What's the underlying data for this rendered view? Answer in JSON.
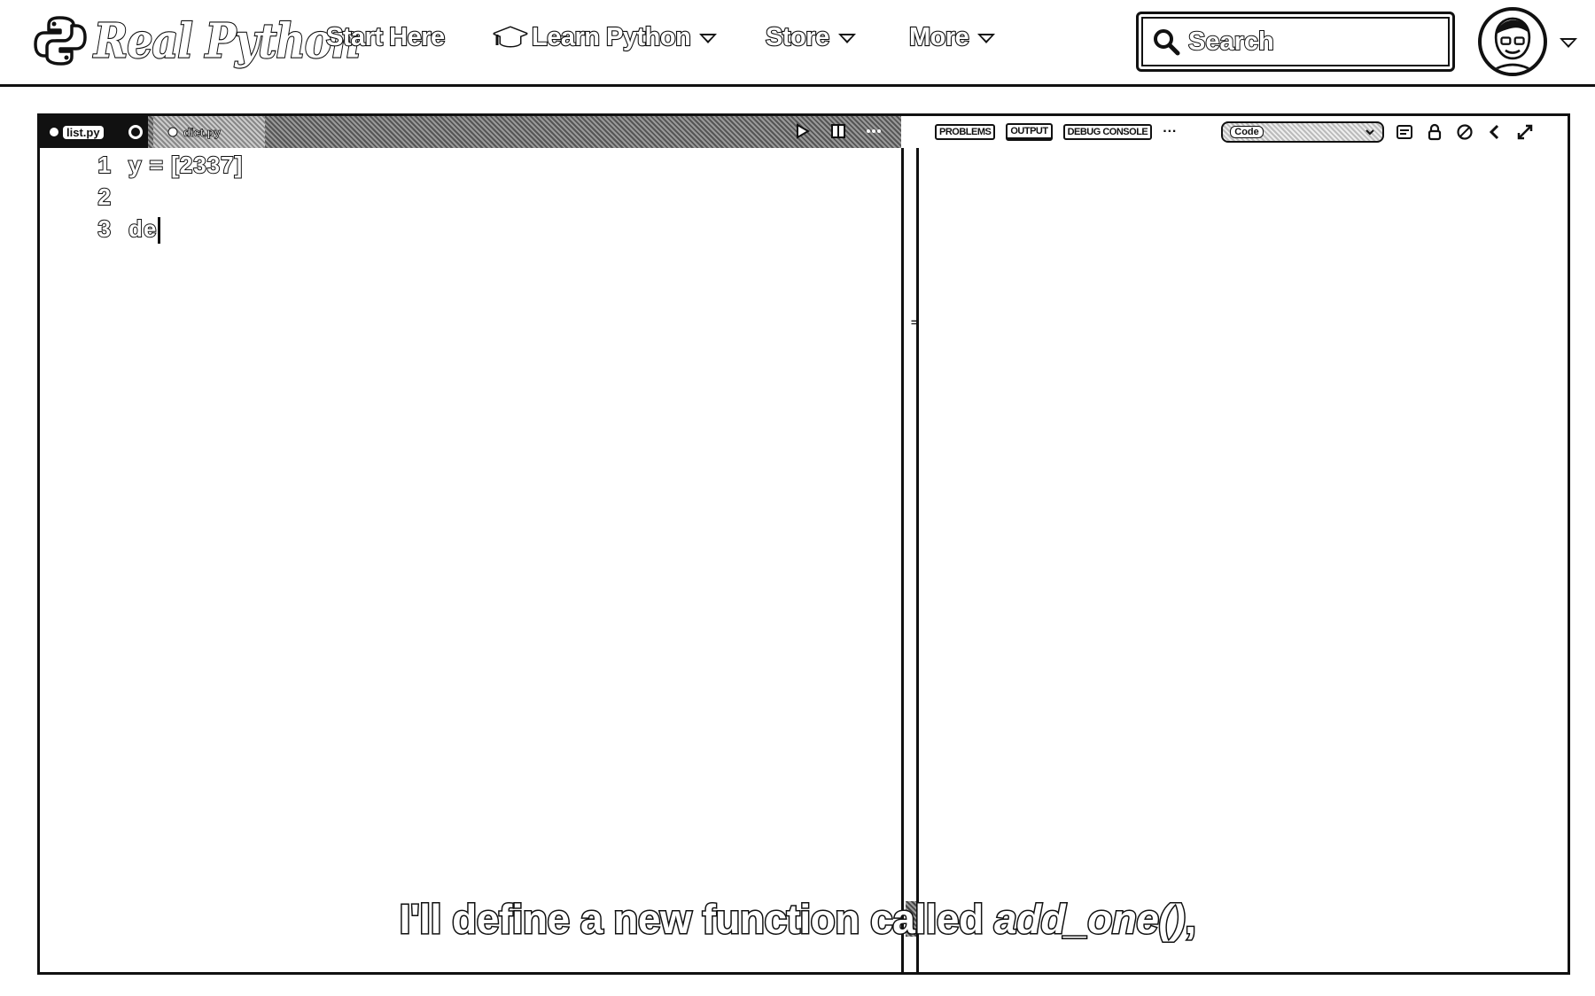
{
  "brand": {
    "name": "Real Python"
  },
  "nav": {
    "start_here": "Start Here",
    "learn_python": "Learn Python",
    "store": "Store",
    "more": "More"
  },
  "search": {
    "placeholder": "Search"
  },
  "editor": {
    "tabs": [
      {
        "label": "list.py"
      },
      {
        "label": "dict.py"
      }
    ],
    "lines": [
      {
        "num": "1",
        "text": "y = [2337]"
      },
      {
        "num": "2",
        "text": ""
      },
      {
        "num": "3",
        "text": "de"
      }
    ]
  },
  "panel": {
    "tabs": [
      "PROBLEMS",
      "OUTPUT",
      "DEBUG CONSOLE"
    ],
    "more": "···",
    "dropdown_value": "Code"
  },
  "caption": {
    "plain": "I'll define a new function called ",
    "code": "add_one()",
    "trail": ","
  }
}
